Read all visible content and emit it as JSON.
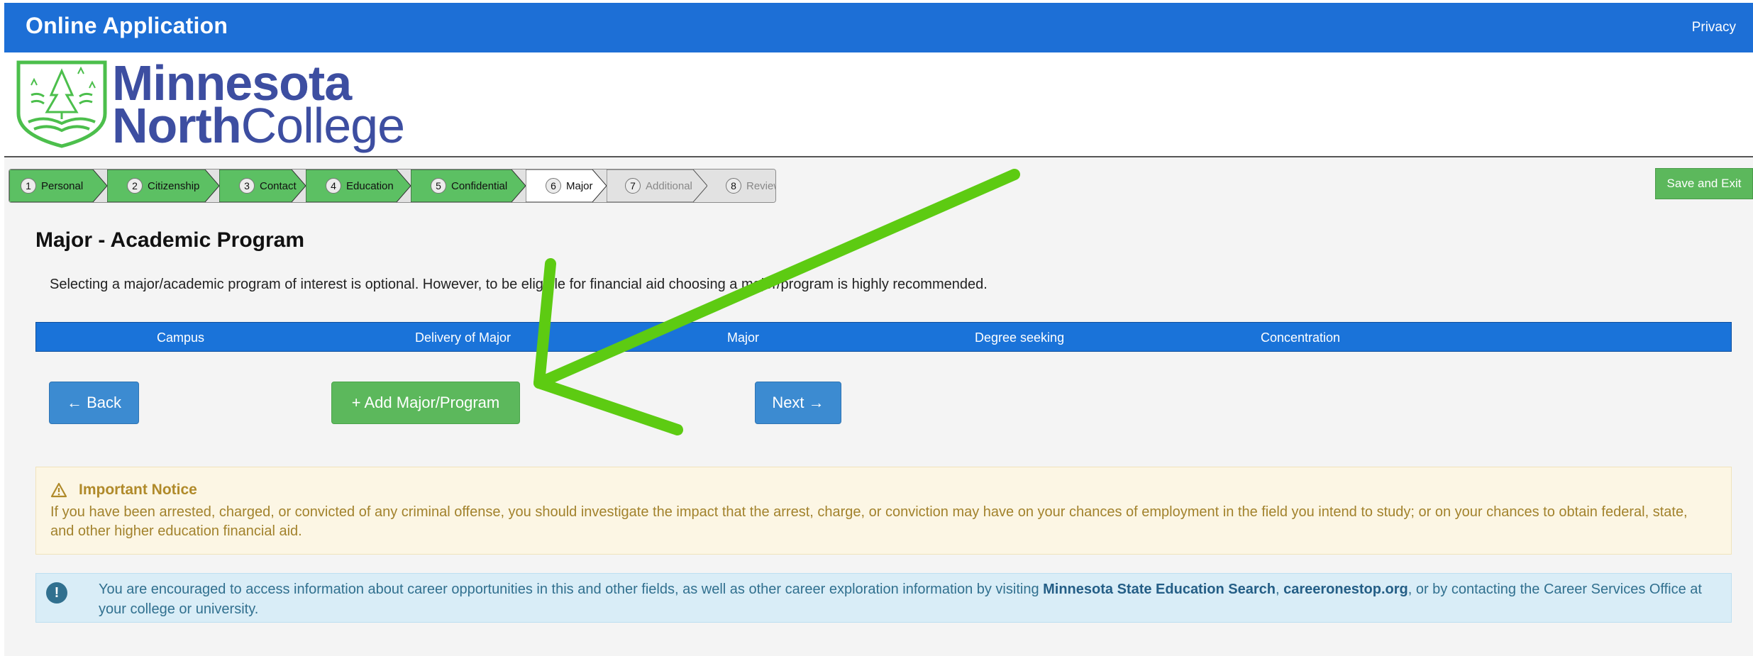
{
  "header": {
    "app_title": "Online Application",
    "privacy_link": "Privacy"
  },
  "logo": {
    "line1": "Minnesota",
    "line2_bold": "North",
    "line2_regular": "College"
  },
  "steps": [
    {
      "number": "1",
      "label": "Personal",
      "state": "complete"
    },
    {
      "number": "2",
      "label": "Citizenship",
      "state": "complete"
    },
    {
      "number": "3",
      "label": "Contact",
      "state": "complete"
    },
    {
      "number": "4",
      "label": "Education",
      "state": "complete"
    },
    {
      "number": "5",
      "label": "Confidential",
      "state": "complete"
    },
    {
      "number": "6",
      "label": "Major",
      "state": "current"
    },
    {
      "number": "7",
      "label": "Additional",
      "state": "todo"
    },
    {
      "number": "8",
      "label": "Review",
      "state": "todo"
    }
  ],
  "save_exit_label": "Save and Exit",
  "page_title": "Major - Academic Program",
  "intro_text": "Selecting a major/academic program of interest is optional. However, to be eligible for financial aid choosing a major/program is highly recommended.",
  "table_columns": [
    "Campus",
    "Delivery of Major",
    "Major",
    "Degree seeking",
    "Concentration"
  ],
  "buttons": {
    "back": "← Back",
    "add": "+ Add Major/Program",
    "next": "Next →"
  },
  "notice": {
    "title": "Important Notice",
    "body": "If you have been arrested, charged, or convicted of any criminal offense, you should investigate the impact that the arrest, charge, or conviction may have on your chances of employment in the field you intend to study; or on your chances to obtain federal, state, and other higher education financial aid."
  },
  "info": {
    "text_before": "You are encouraged to access information about career opportunities in this and other fields, as well as other career exploration information by visiting ",
    "link1": "Minnesota State Education Search",
    "sep": ", ",
    "link2": "careeronestop.org",
    "text_after": ", or by contacting the Career Services Office at your college or university."
  },
  "colors": {
    "header_blue": "#1d6fd6",
    "step_complete": "#5cc063",
    "button_blue": "#3c8bd1",
    "button_green": "#5cb85c",
    "annotation_arrow": "#5dcb12"
  },
  "icons": {
    "notice_icon": "warning-triangle-icon",
    "info_icon": "exclamation-circle-icon"
  }
}
